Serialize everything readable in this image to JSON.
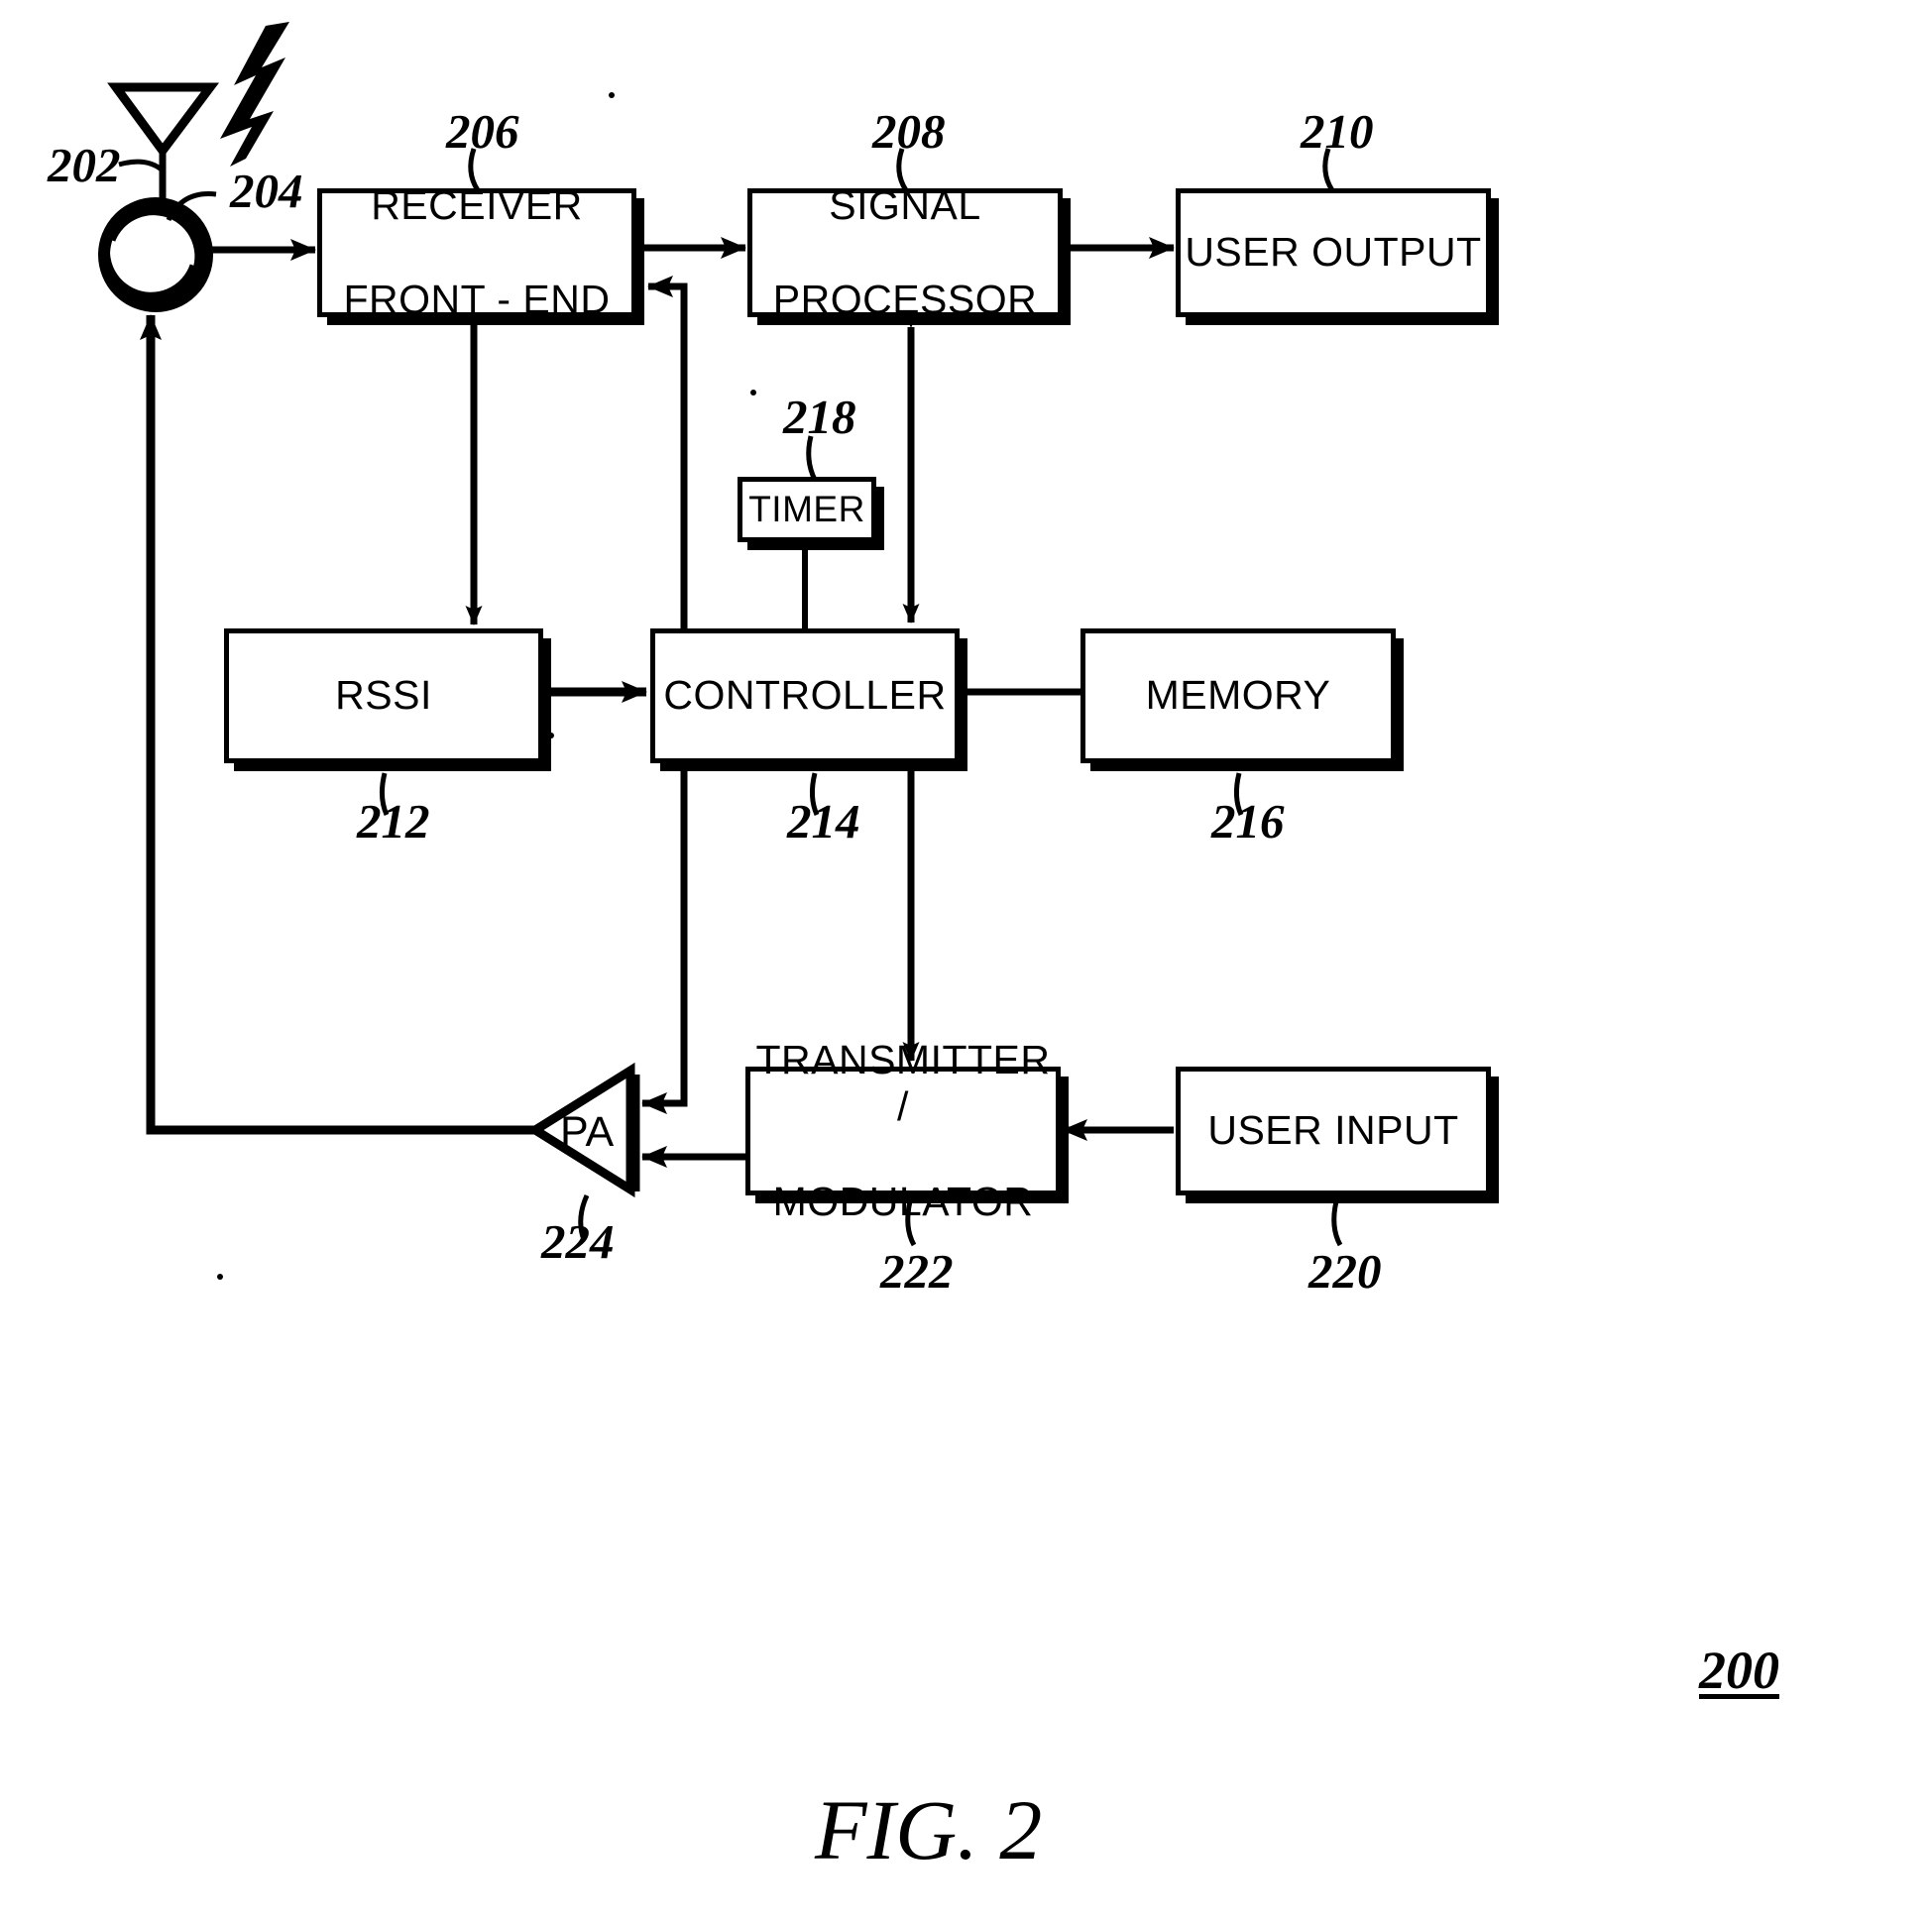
{
  "figure": {
    "caption": "FIG. 2",
    "system_ref": "200",
    "type": "patent-block-diagram",
    "title_absent": true
  },
  "blocks": [
    {
      "id": "antenna",
      "label": "",
      "ref": "202",
      "kind": "antenna-symbol"
    },
    {
      "id": "circulator",
      "label": "",
      "ref": "204",
      "kind": "circulator-symbol"
    },
    {
      "id": "receiver",
      "label": "RECEIVER\nFRONT - END",
      "ref": "206",
      "kind": "box",
      "line1": "RECEIVER",
      "line2": "FRONT - END"
    },
    {
      "id": "sigproc",
      "label": "SIGNAL\nPROCESSOR",
      "ref": "208",
      "kind": "box",
      "line1": "SIGNAL",
      "line2": "PROCESSOR"
    },
    {
      "id": "useroutput",
      "label": "USER OUTPUT",
      "ref": "210",
      "kind": "box",
      "line1": "USER OUTPUT",
      "line2": ""
    },
    {
      "id": "rssi",
      "label": "RSSI",
      "ref": "212",
      "kind": "box",
      "line1": "RSSI",
      "line2": ""
    },
    {
      "id": "controller",
      "label": "CONTROLLER",
      "ref": "214",
      "kind": "box",
      "line1": "CONTROLLER",
      "line2": ""
    },
    {
      "id": "memory",
      "label": "MEMORY",
      "ref": "216",
      "kind": "box",
      "line1": "MEMORY",
      "line2": ""
    },
    {
      "id": "timer",
      "label": "TIMER",
      "ref": "218",
      "kind": "box",
      "line1": "TIMER",
      "line2": ""
    },
    {
      "id": "userinput",
      "label": "USER INPUT",
      "ref": "220",
      "kind": "box",
      "line1": "USER INPUT",
      "line2": ""
    },
    {
      "id": "transmitter",
      "label": "TRANSMITTER /\nMODULATOR",
      "ref": "222",
      "kind": "box",
      "line1": "TRANSMITTER /",
      "line2": "MODULATOR"
    },
    {
      "id": "pa",
      "label": "PA",
      "ref": "224",
      "kind": "amplifier-triangle",
      "line1": "PA",
      "line2": ""
    }
  ],
  "connections": [
    {
      "from": "circulator",
      "to": "receiver",
      "arrow": "single"
    },
    {
      "from": "receiver",
      "to": "sigproc",
      "arrow": "single"
    },
    {
      "from": "sigproc",
      "to": "useroutput",
      "arrow": "single"
    },
    {
      "from": "controller",
      "to": "receiver",
      "arrow": "single"
    },
    {
      "from": "receiver",
      "to": "rssi",
      "arrow": "single"
    },
    {
      "from": "sigproc",
      "to": "controller",
      "arrow": "double"
    },
    {
      "from": "timer",
      "to": "controller",
      "arrow": "none"
    },
    {
      "from": "rssi",
      "to": "controller",
      "arrow": "double"
    },
    {
      "from": "controller",
      "to": "memory",
      "arrow": "none"
    },
    {
      "from": "controller",
      "to": "transmitter",
      "arrow": "single"
    },
    {
      "from": "controller",
      "to": "pa",
      "arrow": "single"
    },
    {
      "from": "transmitter",
      "to": "pa",
      "arrow": "single"
    },
    {
      "from": "userinput",
      "to": "transmitter",
      "arrow": "single"
    },
    {
      "from": "pa",
      "to": "circulator",
      "arrow": "single"
    }
  ],
  "colors": {
    "ink": "#000000",
    "paper": "#ffffff"
  }
}
